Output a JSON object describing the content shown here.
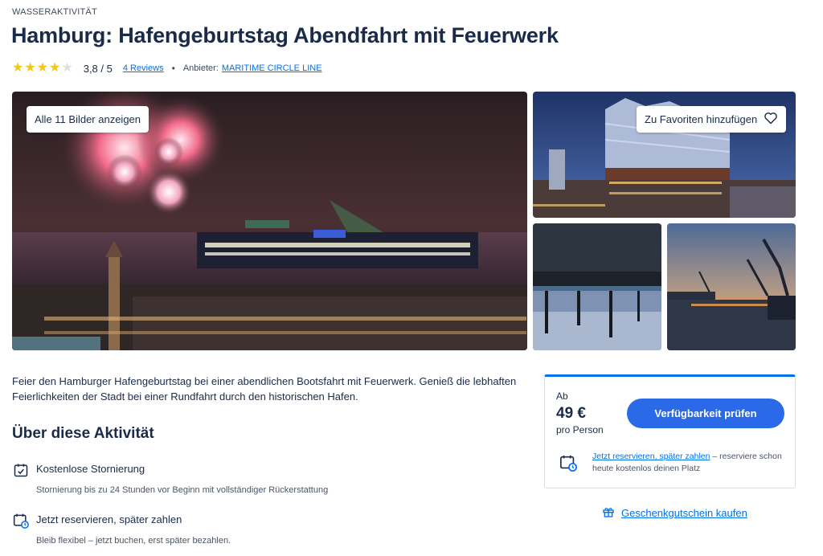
{
  "header": {
    "category": "WASSERAKTIVITÄT",
    "title": "Hamburg: Hafengeburtstag Abendfahrt mit Feuerwerk"
  },
  "rating": {
    "stars_filled": 4,
    "stars_total": 5,
    "value_text": "3,8 / 5",
    "reviews_link": "4 Reviews",
    "separator": "•",
    "provider_label": "Anbieter:",
    "provider_name": "MARITIME CIRCLE LINE",
    "star_color": "#f5c518"
  },
  "gallery": {
    "show_all_button": "Alle 11 Bilder anzeigen",
    "favorite_button": "Zu Favoriten hinzufügen",
    "favorite_icon": "heart-icon"
  },
  "description": "Feier den Hamburger Hafengeburtstag bei einer abendlichen Bootsfahrt mit Feuerwerk. Genieß die lebhaften Feierlichkeiten der Stadt bei einer Rundfahrt durch den historischen Hafen.",
  "about": {
    "title": "Über diese Aktivität",
    "features": [
      {
        "icon": "calendar-check-icon",
        "title": "Kostenlose Stornierung",
        "subtitle": "Stornierung bis zu 24 Stunden vor Beginn mit vollständiger Rückerstattung"
      },
      {
        "icon": "calendar-clock-icon",
        "title": "Jetzt reservieren, später zahlen",
        "subtitle": "Bleib flexibel – jetzt buchen, erst später bezahlen."
      }
    ]
  },
  "booking": {
    "from_label": "Ab",
    "price": "49 €",
    "per_label": "pro Person",
    "availability_button": "Verfügbarkeit prüfen",
    "reserve_link": "Jetzt reservieren, später zahlen",
    "reserve_text": " – reserviere schon heute kostenlos deinen Platz",
    "accent_color": "#0071eb",
    "button_color": "#2a6ae9"
  },
  "gift": {
    "label": "Geschenkgutschein kaufen",
    "icon": "gift-icon"
  }
}
